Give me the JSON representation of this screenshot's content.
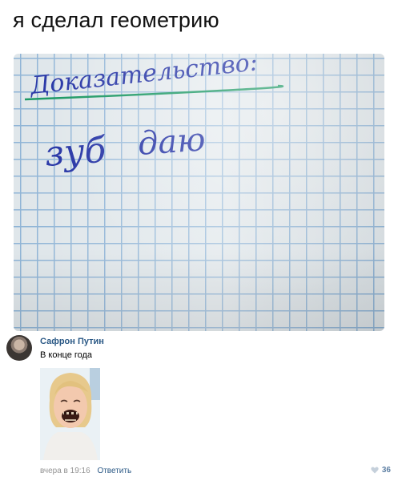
{
  "post": {
    "title": "я сделал геометрию",
    "photo_text_line1": "Доказательство:",
    "photo_text_line2_a": "зуб",
    "photo_text_line2_b": "даю"
  },
  "comment": {
    "author": "Сафрон Путин",
    "text": "В конце года",
    "timestamp": "вчера в 19:16",
    "reply_label": "Ответить",
    "likes": "36"
  },
  "colors": {
    "link": "#2a5885",
    "meta": "#939393",
    "grid": "#8fb4d6",
    "ink": "#2c3aa8",
    "underline": "#1f9a66"
  }
}
